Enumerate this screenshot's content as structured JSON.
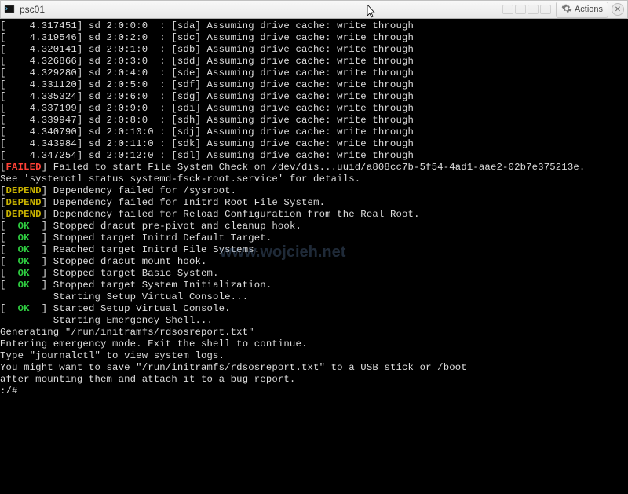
{
  "titlebar": {
    "title": "psc01",
    "actions_label": "Actions"
  },
  "colors": {
    "ok": "#2ecc40",
    "failed": "#ff4136",
    "depend": "#c9b200"
  },
  "watermark": "www.wojcieh.net",
  "messages": {
    "sd": [
      {
        "ts": "4.317451",
        "dev": "sd 2:0:0:0",
        "blk": "[sda]",
        "text": "Assuming drive cache: write through"
      },
      {
        "ts": "4.319546",
        "dev": "sd 2:0:2:0",
        "blk": "[sdc]",
        "text": "Assuming drive cache: write through"
      },
      {
        "ts": "4.320141",
        "dev": "sd 2:0:1:0",
        "blk": "[sdb]",
        "text": "Assuming drive cache: write through"
      },
      {
        "ts": "4.326866",
        "dev": "sd 2:0:3:0",
        "blk": "[sdd]",
        "text": "Assuming drive cache: write through"
      },
      {
        "ts": "4.329280",
        "dev": "sd 2:0:4:0",
        "blk": "[sde]",
        "text": "Assuming drive cache: write through"
      },
      {
        "ts": "4.331120",
        "dev": "sd 2:0:5:0",
        "blk": "[sdf]",
        "text": "Assuming drive cache: write through"
      },
      {
        "ts": "4.335324",
        "dev": "sd 2:0:6:0",
        "blk": "[sdg]",
        "text": "Assuming drive cache: write through"
      },
      {
        "ts": "4.337199",
        "dev": "sd 2:0:9:0",
        "blk": "[sdi]",
        "text": "Assuming drive cache: write through"
      },
      {
        "ts": "4.339947",
        "dev": "sd 2:0:8:0",
        "blk": "[sdh]",
        "text": "Assuming drive cache: write through"
      },
      {
        "ts": "4.340790",
        "dev": "sd 2:0:10:0",
        "blk": "[sdj]",
        "text": "Assuming drive cache: write through"
      },
      {
        "ts": "4.343984",
        "dev": "sd 2:0:11:0",
        "blk": "[sdk]",
        "text": "Assuming drive cache: write through"
      },
      {
        "ts": "4.347254",
        "dev": "sd 2:0:12:0",
        "blk": "[sdl]",
        "text": "Assuming drive cache: write through"
      }
    ],
    "failed": "Failed to start File System Check on /dev/dis...uuid/a808cc7b-5f54-4ad1-aae2-02b7e375213e.",
    "see": "See 'systemctl status systemd-fsck-root.service' for details.",
    "depend": [
      "Dependency failed for /sysroot.",
      "Dependency failed for Initrd Root File System.",
      "Dependency failed for Reload Configuration from the Real Root."
    ],
    "ok": [
      "Stopped dracut pre-pivot and cleanup hook.",
      "Stopped target Initrd Default Target.",
      "Reached target Initrd File Systems.",
      "Stopped dracut mount hook.",
      "Stopped target Basic System.",
      "Stopped target System Initialization."
    ],
    "starting_vc": "Starting Setup Virtual Console...",
    "ok_vc": "Started Setup Virtual Console.",
    "starting_shell": "Starting Emergency Shell...",
    "generating": "Generating \"/run/initramfs/rdsosreport.txt\"",
    "emergency": [
      "Entering emergency mode. Exit the shell to continue.",
      "Type \"journalctl\" to view system logs.",
      "You might want to save \"/run/initramfs/rdsosreport.txt\" to a USB stick or /boot",
      "after mounting them and attach it to a bug report."
    ],
    "prompt": ":/#"
  },
  "labels": {
    "FAILED": "FAILED",
    "DEPEND": "DEPEND",
    "OK": "OK"
  }
}
